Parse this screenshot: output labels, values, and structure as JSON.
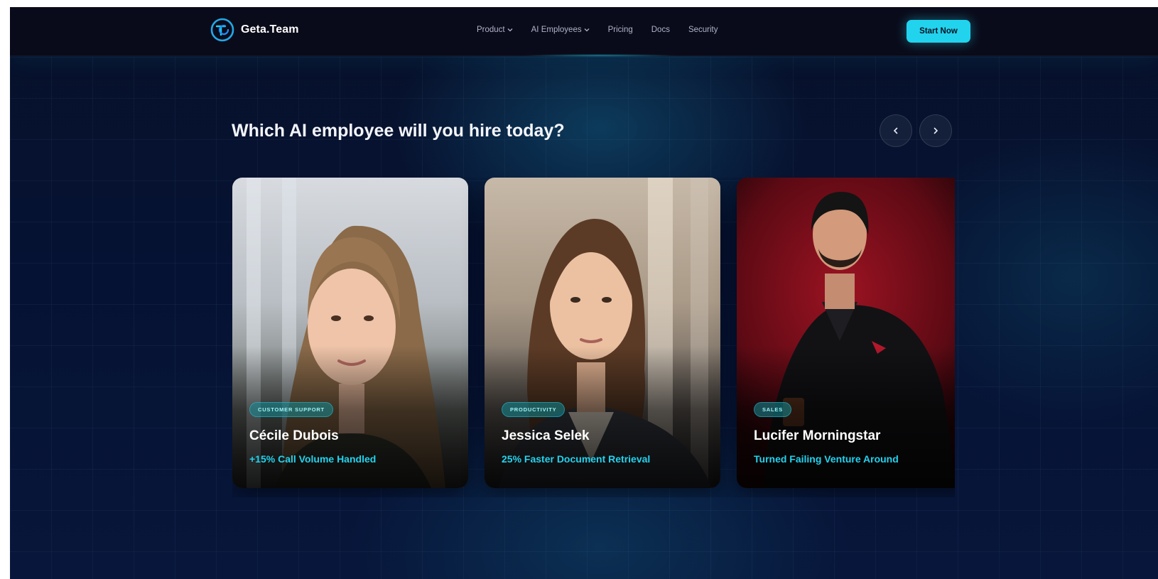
{
  "brand": {
    "name": "Geta.Team",
    "logo_icon": "geta-team-logo-icon"
  },
  "nav": {
    "links": [
      {
        "label": "Product",
        "dropdown": true
      },
      {
        "label": "AI Employees",
        "dropdown": true
      },
      {
        "label": "Pricing",
        "dropdown": false
      },
      {
        "label": "Docs",
        "dropdown": false
      },
      {
        "label": "Security",
        "dropdown": false
      }
    ],
    "cta_label": "Start Now"
  },
  "section": {
    "title": "Which AI employee will you hire today?",
    "prev_icon": "chevron-left-icon",
    "next_icon": "chevron-right-icon"
  },
  "cards": [
    {
      "tag": "CUSTOMER SUPPORT",
      "name": "Cécile Dubois",
      "stat": "+15% Call Volume Handled"
    },
    {
      "tag": "PRODUCTIVITY",
      "name": "Jessica Selek",
      "stat": "25% Faster Document Retrieval"
    },
    {
      "tag": "SALES",
      "name": "Lucifer Morningstar",
      "stat": "Turned Failing Venture Around"
    }
  ],
  "colors": {
    "accent": "#22d3ee",
    "nav_background": "#0a0b1a",
    "page_background": "#061233"
  }
}
